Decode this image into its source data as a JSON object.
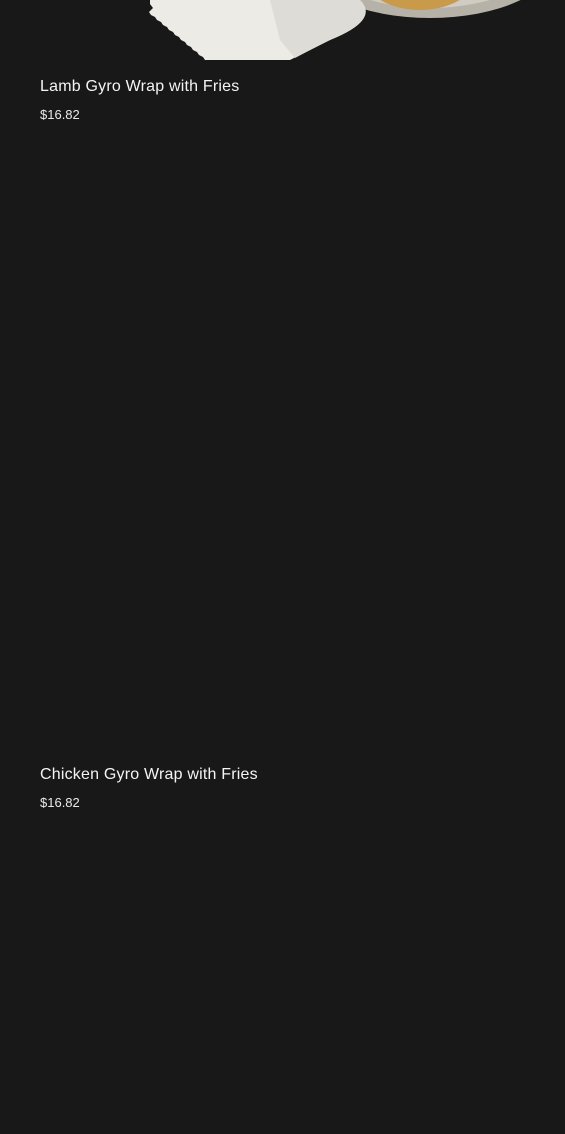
{
  "products": [
    {
      "name": "Lamb Gyro Wrap with Fries",
      "price": "$16.82"
    },
    {
      "name": "Chicken Gyro Wrap with Fries",
      "price": "$16.82"
    }
  ]
}
